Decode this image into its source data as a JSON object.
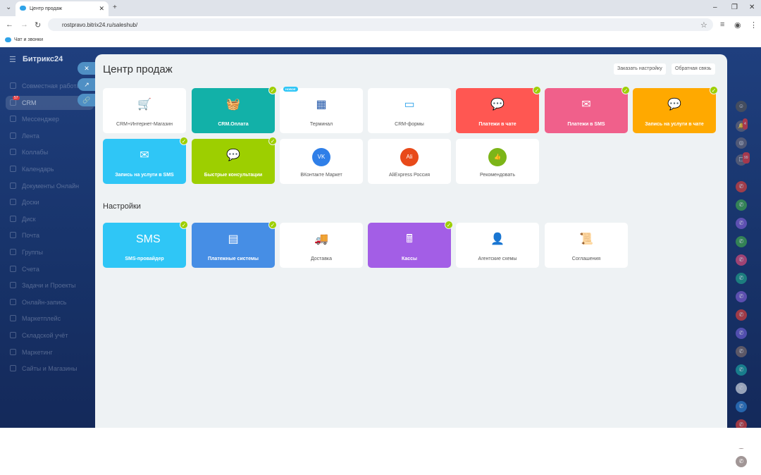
{
  "browser": {
    "tab_title": "Центр продаж",
    "url": "rostpravo.bitrix24.ru/saleshub/",
    "bookmark": "Чат и звонки"
  },
  "sidebar": {
    "logo": "Битрикс24",
    "crm_badge": "57",
    "items": [
      "Совместная работа",
      "CRM",
      "Мессенджер",
      "Лента",
      "Коллабы",
      "Календарь",
      "Документы Онлайн",
      "Доски",
      "Диск",
      "Почта",
      "Группы",
      "Счета",
      "Задачи и Проекты",
      "Онлайн-запись",
      "Маркетплейс",
      "Складской учёт",
      "Маркетинг",
      "Сайты и Магазины"
    ]
  },
  "page": {
    "title": "Центр продаж",
    "order_setup": "Заказать настройку",
    "feedback": "Обратная связь",
    "settings_title": "Настройки",
    "new_badge": "НОВОЕ"
  },
  "tiles": [
    {
      "label": "CRM+Интернет-Магазин",
      "color": "#ffffff",
      "icon": "shop-cart-icon",
      "checked": false
    },
    {
      "label": "CRM.Оплата",
      "color": "#12b1a8",
      "icon": "basket-icon",
      "checked": true
    },
    {
      "label": "Терминал",
      "color": "#ffffff",
      "icon": "terminal-icon",
      "checked": false
    },
    {
      "label": "CRM-формы",
      "color": "#ffffff",
      "icon": "form-icon",
      "checked": false
    },
    {
      "label": "Платежи в чате",
      "color": "#ff5752",
      "icon": "chat-payment-icon",
      "checked": true
    },
    {
      "label": "Платежи в SMS",
      "color": "#f0608b",
      "icon": "sms-payment-icon",
      "checked": true
    },
    {
      "label": "Запись на услуги в чате",
      "color": "#ffa900",
      "icon": "booking-chat-icon",
      "checked": true
    },
    {
      "label": "Запись на услуги в SMS",
      "color": "#2fc6f6",
      "icon": "booking-sms-icon",
      "checked": true
    },
    {
      "label": "Быстрые консультации",
      "color": "#9dcf00",
      "icon": "consult-icon",
      "checked": true
    },
    {
      "label": "ВКонтакте Маркет",
      "color": "#ffffff",
      "icon": "vk-market-icon",
      "checked": false
    },
    {
      "label": "AliExpress Россия",
      "color": "#ffffff",
      "icon": "aliexpress-icon",
      "checked": false
    },
    {
      "label": "Рекомендовать",
      "color": "#ffffff",
      "icon": "thumbs-up-icon",
      "checked": false
    }
  ],
  "settings": [
    {
      "label": "SMS-провайдер",
      "color": "#2fc6f6",
      "icon": "sms-icon",
      "checked": true
    },
    {
      "label": "Платежные системы",
      "color": "#468ee5",
      "icon": "payment-systems-icon",
      "checked": true
    },
    {
      "label": "Доставка",
      "color": "#ffffff",
      "icon": "truck-icon",
      "checked": false
    },
    {
      "label": "Кассы",
      "color": "#a35ee6",
      "icon": "cash-register-icon",
      "checked": true
    },
    {
      "label": "Агентские схемы",
      "color": "#ffffff",
      "icon": "agent-icon",
      "checked": false
    },
    {
      "label": "Соглашения",
      "color": "#ffffff",
      "icon": "agreement-icon",
      "checked": false
    }
  ],
  "right_bar": {
    "notif_count": "4",
    "chat_count": "99",
    "call_colors": [
      "#d9403b",
      "#3fa34d",
      "#7a5ccf",
      "#3fa34d",
      "#d94b7a",
      "#1f9e88",
      "#7a5ccf",
      "#d9403b",
      "#6a5ccf",
      "#7a6a6a",
      "#1aa0a0",
      "#cfd6e0",
      "#2f7fcf",
      "#d9403b",
      "#7a6a6a",
      "#7a6a6a"
    ]
  }
}
